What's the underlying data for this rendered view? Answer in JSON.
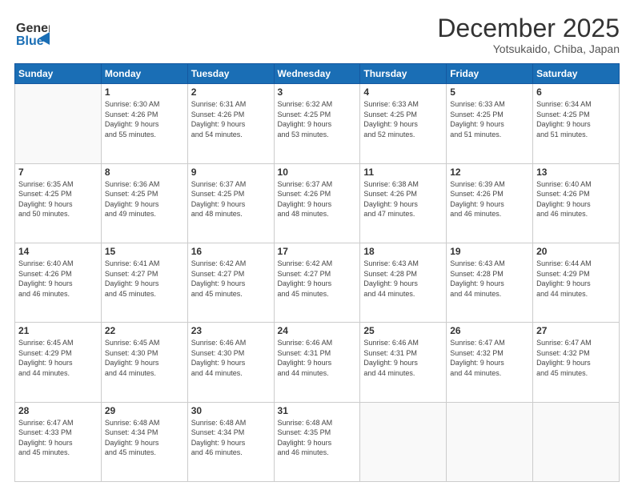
{
  "header": {
    "logo_line1": "General",
    "logo_line2": "Blue",
    "title": "December 2025",
    "subtitle": "Yotsukaido, Chiba, Japan"
  },
  "calendar": {
    "days_of_week": [
      "Sunday",
      "Monday",
      "Tuesday",
      "Wednesday",
      "Thursday",
      "Friday",
      "Saturday"
    ],
    "weeks": [
      [
        {
          "day": "",
          "info": ""
        },
        {
          "day": "1",
          "info": "Sunrise: 6:30 AM\nSunset: 4:26 PM\nDaylight: 9 hours\nand 55 minutes."
        },
        {
          "day": "2",
          "info": "Sunrise: 6:31 AM\nSunset: 4:26 PM\nDaylight: 9 hours\nand 54 minutes."
        },
        {
          "day": "3",
          "info": "Sunrise: 6:32 AM\nSunset: 4:25 PM\nDaylight: 9 hours\nand 53 minutes."
        },
        {
          "day": "4",
          "info": "Sunrise: 6:33 AM\nSunset: 4:25 PM\nDaylight: 9 hours\nand 52 minutes."
        },
        {
          "day": "5",
          "info": "Sunrise: 6:33 AM\nSunset: 4:25 PM\nDaylight: 9 hours\nand 51 minutes."
        },
        {
          "day": "6",
          "info": "Sunrise: 6:34 AM\nSunset: 4:25 PM\nDaylight: 9 hours\nand 51 minutes."
        }
      ],
      [
        {
          "day": "7",
          "info": "Sunrise: 6:35 AM\nSunset: 4:25 PM\nDaylight: 9 hours\nand 50 minutes."
        },
        {
          "day": "8",
          "info": "Sunrise: 6:36 AM\nSunset: 4:25 PM\nDaylight: 9 hours\nand 49 minutes."
        },
        {
          "day": "9",
          "info": "Sunrise: 6:37 AM\nSunset: 4:25 PM\nDaylight: 9 hours\nand 48 minutes."
        },
        {
          "day": "10",
          "info": "Sunrise: 6:37 AM\nSunset: 4:26 PM\nDaylight: 9 hours\nand 48 minutes."
        },
        {
          "day": "11",
          "info": "Sunrise: 6:38 AM\nSunset: 4:26 PM\nDaylight: 9 hours\nand 47 minutes."
        },
        {
          "day": "12",
          "info": "Sunrise: 6:39 AM\nSunset: 4:26 PM\nDaylight: 9 hours\nand 46 minutes."
        },
        {
          "day": "13",
          "info": "Sunrise: 6:40 AM\nSunset: 4:26 PM\nDaylight: 9 hours\nand 46 minutes."
        }
      ],
      [
        {
          "day": "14",
          "info": "Sunrise: 6:40 AM\nSunset: 4:26 PM\nDaylight: 9 hours\nand 46 minutes."
        },
        {
          "day": "15",
          "info": "Sunrise: 6:41 AM\nSunset: 4:27 PM\nDaylight: 9 hours\nand 45 minutes."
        },
        {
          "day": "16",
          "info": "Sunrise: 6:42 AM\nSunset: 4:27 PM\nDaylight: 9 hours\nand 45 minutes."
        },
        {
          "day": "17",
          "info": "Sunrise: 6:42 AM\nSunset: 4:27 PM\nDaylight: 9 hours\nand 45 minutes."
        },
        {
          "day": "18",
          "info": "Sunrise: 6:43 AM\nSunset: 4:28 PM\nDaylight: 9 hours\nand 44 minutes."
        },
        {
          "day": "19",
          "info": "Sunrise: 6:43 AM\nSunset: 4:28 PM\nDaylight: 9 hours\nand 44 minutes."
        },
        {
          "day": "20",
          "info": "Sunrise: 6:44 AM\nSunset: 4:29 PM\nDaylight: 9 hours\nand 44 minutes."
        }
      ],
      [
        {
          "day": "21",
          "info": "Sunrise: 6:45 AM\nSunset: 4:29 PM\nDaylight: 9 hours\nand 44 minutes."
        },
        {
          "day": "22",
          "info": "Sunrise: 6:45 AM\nSunset: 4:30 PM\nDaylight: 9 hours\nand 44 minutes."
        },
        {
          "day": "23",
          "info": "Sunrise: 6:46 AM\nSunset: 4:30 PM\nDaylight: 9 hours\nand 44 minutes."
        },
        {
          "day": "24",
          "info": "Sunrise: 6:46 AM\nSunset: 4:31 PM\nDaylight: 9 hours\nand 44 minutes."
        },
        {
          "day": "25",
          "info": "Sunrise: 6:46 AM\nSunset: 4:31 PM\nDaylight: 9 hours\nand 44 minutes."
        },
        {
          "day": "26",
          "info": "Sunrise: 6:47 AM\nSunset: 4:32 PM\nDaylight: 9 hours\nand 44 minutes."
        },
        {
          "day": "27",
          "info": "Sunrise: 6:47 AM\nSunset: 4:32 PM\nDaylight: 9 hours\nand 45 minutes."
        }
      ],
      [
        {
          "day": "28",
          "info": "Sunrise: 6:47 AM\nSunset: 4:33 PM\nDaylight: 9 hours\nand 45 minutes."
        },
        {
          "day": "29",
          "info": "Sunrise: 6:48 AM\nSunset: 4:34 PM\nDaylight: 9 hours\nand 45 minutes."
        },
        {
          "day": "30",
          "info": "Sunrise: 6:48 AM\nSunset: 4:34 PM\nDaylight: 9 hours\nand 46 minutes."
        },
        {
          "day": "31",
          "info": "Sunrise: 6:48 AM\nSunset: 4:35 PM\nDaylight: 9 hours\nand 46 minutes."
        },
        {
          "day": "",
          "info": ""
        },
        {
          "day": "",
          "info": ""
        },
        {
          "day": "",
          "info": ""
        }
      ]
    ]
  }
}
